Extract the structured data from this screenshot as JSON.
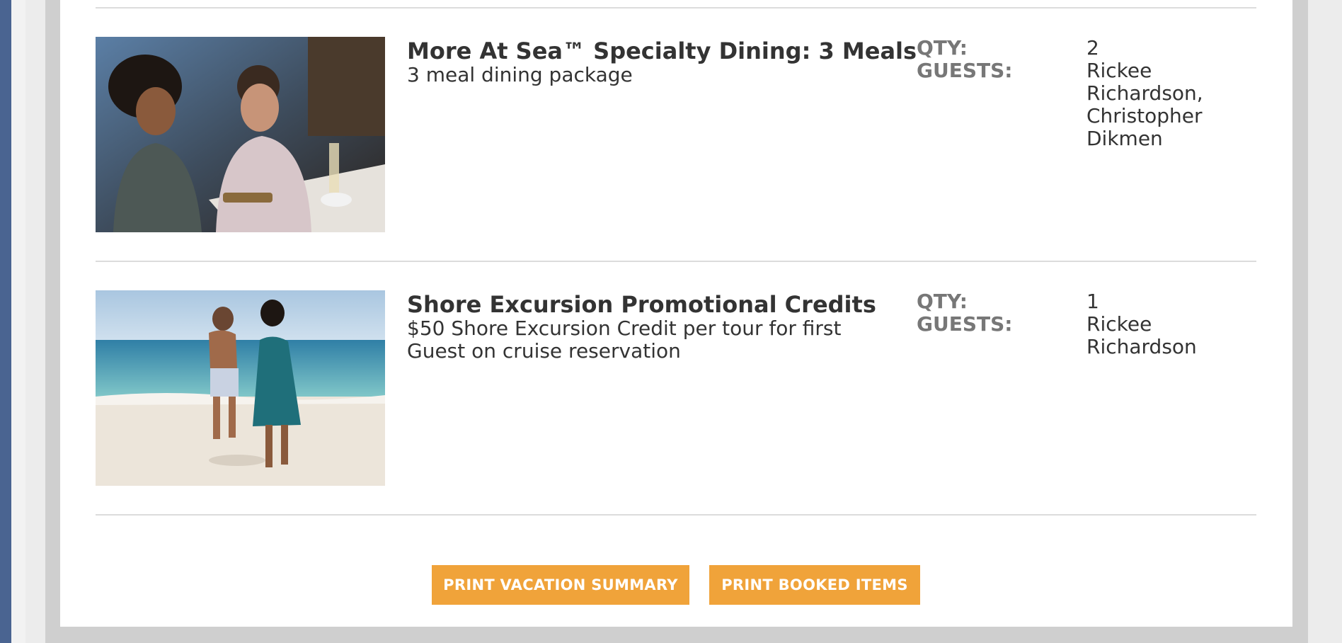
{
  "labels": {
    "qty": "QTY:",
    "guests": "GUESTS:"
  },
  "items": [
    {
      "title": "More At Sea™ Specialty Dining: 3 Meals",
      "description": "3 meal dining package",
      "qty": "2",
      "guests": "Rickee Richardson, Christopher Dikmen",
      "image": "couple-dining-photo"
    },
    {
      "title": "Shore Excursion Promotional Credits",
      "description": "$50 Shore Excursion Credit per tour for first Guest on cruise reservation",
      "qty": "1",
      "guests": "Rickee Richardson",
      "image": "couple-on-beach-photo"
    }
  ],
  "buttons": {
    "print_summary": "PRINT VACATION SUMMARY",
    "print_booked": "PRINT BOOKED ITEMS"
  },
  "colors": {
    "button_bg": "#f0a33a",
    "side_strip": "#4a6491",
    "label_gray": "#777777",
    "text_dark": "#333333"
  }
}
